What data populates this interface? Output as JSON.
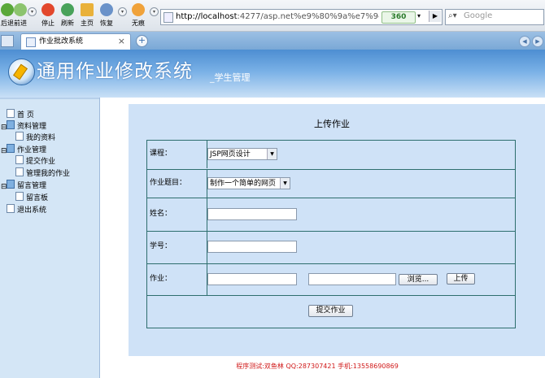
{
  "browser": {
    "nav_buttons": [
      {
        "label": "后退"
      },
      {
        "label": "前进"
      },
      {
        "label": "停止"
      },
      {
        "label": "刷新"
      },
      {
        "label": "主页"
      },
      {
        "label": "恢复"
      },
      {
        "label": "无痕"
      }
    ],
    "address": {
      "host": "http://localhost",
      "rest": ":4277/asp.net%e9%80%9a%e7%94%a",
      "badge": "360"
    },
    "search": {
      "placeholder": "Google"
    },
    "tab": {
      "title": "作业批改系统",
      "close": "×"
    },
    "new_tab": "+"
  },
  "site": {
    "title": "通用作业修改系统",
    "subtitle": "_学生管理"
  },
  "sidebar": {
    "items": [
      {
        "label": "首 页"
      },
      {
        "label": "资料管理"
      },
      {
        "label": "我的资料"
      },
      {
        "label": "作业管理"
      },
      {
        "label": "提交作业"
      },
      {
        "label": "管理我的作业"
      },
      {
        "label": "留言管理"
      },
      {
        "label": "留言板"
      },
      {
        "label": "退出系统"
      }
    ]
  },
  "form": {
    "title": "上传作业",
    "course_label": "课程：",
    "course_value": "JSP网页设计",
    "topic_label": "作业题目：",
    "topic_value": "制作一个简单的网页",
    "name_label": "姓名：",
    "name_value": "",
    "id_label": "学号：",
    "id_value": "",
    "hw_label": "作业：",
    "browse_label": "浏览...",
    "upload_label": "上传",
    "submit_label": "提交作业"
  },
  "footer": {
    "text": "程序测试:双鱼林 QQ:287307421 手机:13558690869"
  },
  "colors": {
    "header_blue": "#4d8ed2",
    "sidebar_bg": "#d4e6f6",
    "panel_bg": "#cfe2f7",
    "table_border": "#2e6e6e",
    "footer_red": "#d01818"
  }
}
